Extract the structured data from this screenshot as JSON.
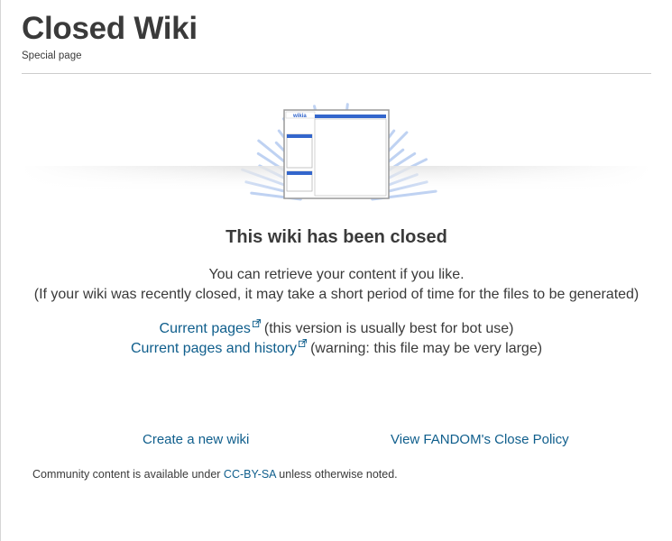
{
  "page": {
    "title": "Closed Wiki",
    "subtitle": "Special page"
  },
  "illustration": {
    "logo_text": "wikia"
  },
  "main": {
    "heading": "This wiki has been closed",
    "retrieve": "You can retrieve your content if you like.",
    "note": "(If your wiki was recently closed, it may take a short period of time for the files to be generated)"
  },
  "downloads": [
    {
      "link": "Current pages",
      "note": "(this version is usually best for bot use)"
    },
    {
      "link": "Current pages and history",
      "note": "(warning: this file may be very large)"
    }
  ],
  "footer": {
    "create_wiki": "Create a new wiki",
    "close_policy": "View FANDOM's Close Policy"
  },
  "license": {
    "prefix": "Community content is available under ",
    "link": "CC-BY-SA",
    "suffix": " unless otherwise noted."
  },
  "colors": {
    "link": "#0f5e8c",
    "text": "#3a3a3a",
    "ray": "#aac4ee",
    "window_bar": "#3366cc"
  }
}
